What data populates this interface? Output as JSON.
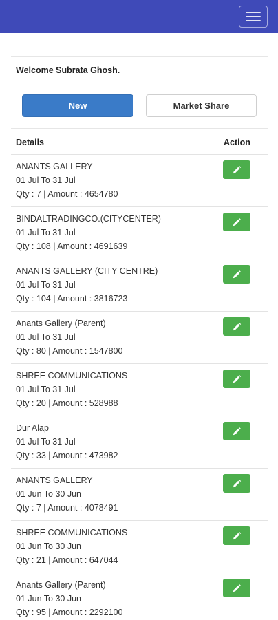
{
  "header": {
    "menu_icon": "hamburger-menu-icon"
  },
  "welcome_text": "Welcome Subrata Ghosh.",
  "buttons": {
    "new_label": "New",
    "market_share_label": "Market Share"
  },
  "table": {
    "headers": {
      "details": "Details",
      "action": "Action"
    },
    "rows": [
      {
        "name": "ANANTS GALLERY",
        "period": "01 Jul To 31 Jul",
        "summary": "Qty : 7 | Amount : 4654780"
      },
      {
        "name": "BINDALTRADINGCO.(CITYCENTER)",
        "period": "01 Jul To 31 Jul",
        "summary": "Qty : 108 | Amount : 4691639"
      },
      {
        "name": "ANANTS GALLERY (CITY CENTRE)",
        "period": "01 Jul To 31 Jul",
        "summary": "Qty : 104 | Amount : 3816723"
      },
      {
        "name": "Anants Gallery (Parent)",
        "period": "01 Jul To 31 Jul",
        "summary": "Qty : 80 | Amount : 1547800"
      },
      {
        "name": "SHREE COMMUNICATIONS",
        "period": "01 Jul To 31 Jul",
        "summary": "Qty : 20 | Amount : 528988"
      },
      {
        "name": "Dur Alap",
        "period": "01 Jul To 31 Jul",
        "summary": "Qty : 33 | Amount : 473982"
      },
      {
        "name": "ANANTS GALLERY",
        "period": "01 Jun To 30 Jun",
        "summary": "Qty : 7 | Amount : 4078491"
      },
      {
        "name": "SHREE COMMUNICATIONS",
        "period": "01 Jun To 30 Jun",
        "summary": "Qty : 21 | Amount : 647044"
      },
      {
        "name": "Anants Gallery (Parent)",
        "period": "01 Jun To 30 Jun",
        "summary": "Qty : 95 | Amount : 2292100"
      }
    ]
  },
  "colors": {
    "topbar": "#3f4ab8",
    "primary_button": "#3a7bc8",
    "edit_button": "#4cae4c"
  },
  "icons": {
    "edit": "pencil-icon"
  }
}
